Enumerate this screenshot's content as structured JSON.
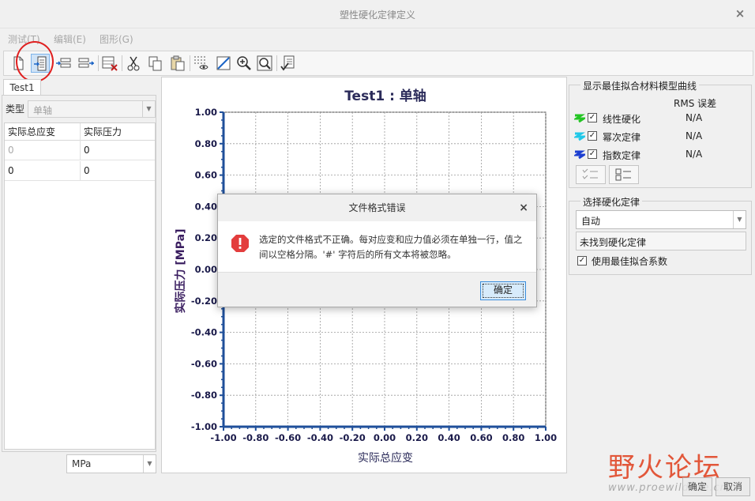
{
  "window": {
    "title": "塑性硬化定律定义",
    "close_glyph": "×"
  },
  "menu": [
    {
      "label": "测试(T)"
    },
    {
      "label": "编辑(E)"
    },
    {
      "label": "图形(G)"
    }
  ],
  "toolbar": {
    "icons": [
      "new-file-icon",
      "import-file-icon",
      "insert-row-before-icon",
      "insert-row-after-icon",
      "delete-rows-icon",
      "cut-icon",
      "copy-icon",
      "paste-icon",
      "show-grid-icon",
      "refit-icon",
      "zoom-in-icon",
      "zoom-window-icon",
      "check-list-icon"
    ]
  },
  "left": {
    "tab": "Test1",
    "type_label": "类型",
    "type_value": "单轴",
    "columns": [
      "实际总应变",
      "实际压力"
    ],
    "rows": [
      [
        "0",
        "0"
      ],
      [
        "0",
        "0"
      ]
    ],
    "unit": "MPa"
  },
  "chart_data": {
    "type": "line",
    "title": "Test1 : 单轴",
    "xlabel": "实际总应变",
    "ylabel": "实际压力 [MPa]",
    "xlim": [
      -1.0,
      1.0
    ],
    "ylim": [
      -1.0,
      1.0
    ],
    "xticks": [
      "-1.00",
      "-0.80",
      "-0.60",
      "-0.40",
      "-0.20",
      "0.00",
      "0.20",
      "0.40",
      "0.60",
      "0.80",
      "1.00"
    ],
    "yticks": [
      "1.00",
      "0.80",
      "0.60",
      "0.40",
      "0.20",
      "0.00",
      "-0.20",
      "-0.40",
      "-0.60",
      "-0.80",
      "-1.00"
    ],
    "grid": true,
    "series": []
  },
  "fit": {
    "title": "显示最佳拟合材料模型曲线",
    "rms_header": "RMS 误差",
    "models": [
      {
        "label": "线性硬化",
        "value": "N/A",
        "color": "#22c522",
        "checked": "✓"
      },
      {
        "label": "幂次定律",
        "value": "N/A",
        "color": "#20c8e8",
        "checked": "✓"
      },
      {
        "label": "指数定律",
        "value": "N/A",
        "color": "#1c3fd1",
        "checked": "✓"
      }
    ]
  },
  "law": {
    "title": "选择硬化定律",
    "selected": "自动",
    "status": "未找到硬化定律",
    "use_best_fit": "使用最佳拟合系数",
    "use_best_fit_check": "✓"
  },
  "buttons": {
    "ok": "确定",
    "cancel": "取消"
  },
  "dialog": {
    "title": "文件格式错误",
    "close_glyph": "×",
    "message": "选定的文件格式不正确。每对应变和应力值必须在单独一行，值之间以空格分隔。'#' 字符后的所有文本将被忽略。",
    "ok": "确定"
  },
  "watermark": {
    "text": "野火论坛",
    "url": "www.proewildfire.cn"
  }
}
